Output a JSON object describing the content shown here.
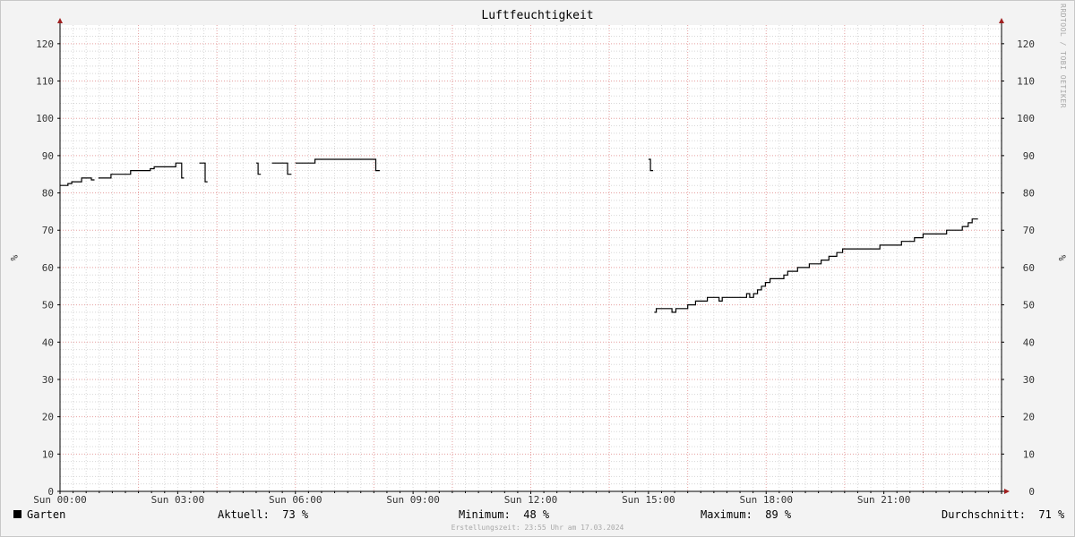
{
  "chart_data": {
    "type": "line",
    "title": "Luftfeuchtigkeit",
    "ylabel": "%",
    "ylim": [
      0,
      125
    ],
    "yticks": [
      "0",
      "10",
      "20",
      "30",
      "40",
      "50",
      "60",
      "70",
      "80",
      "90",
      "100",
      "110",
      "120"
    ],
    "xlim": [
      0,
      24
    ],
    "xticks": [
      {
        "x": 0,
        "label": "Sun 00:00"
      },
      {
        "x": 3,
        "label": "Sun 03:00"
      },
      {
        "x": 6,
        "label": "Sun 06:00"
      },
      {
        "x": 9,
        "label": "Sun 09:00"
      },
      {
        "x": 12,
        "label": "Sun 12:00"
      },
      {
        "x": 15,
        "label": "Sun 15:00"
      },
      {
        "x": 18,
        "label": "Sun 18:00"
      },
      {
        "x": 21,
        "label": "Sun 21:00"
      }
    ],
    "grid": true,
    "series": [
      {
        "name": "Garten",
        "color": "#000000",
        "segments": [
          [
            [
              0.0,
              82
            ],
            [
              0.2,
              82
            ],
            [
              0.2,
              82.5
            ],
            [
              0.3,
              82.5
            ],
            [
              0.3,
              83
            ],
            [
              0.55,
              83
            ],
            [
              0.55,
              84
            ],
            [
              0.8,
              84
            ],
            [
              0.8,
              83.5
            ],
            [
              0.88,
              83.5
            ]
          ],
          [
            [
              0.98,
              84
            ],
            [
              1.3,
              84
            ],
            [
              1.3,
              85
            ],
            [
              1.8,
              85
            ],
            [
              1.8,
              86
            ],
            [
              2.3,
              86
            ],
            [
              2.3,
              86.5
            ],
            [
              2.4,
              86.5
            ],
            [
              2.4,
              87
            ],
            [
              2.95,
              87
            ],
            [
              2.95,
              88
            ],
            [
              3.1,
              88
            ],
            [
              3.1,
              84
            ],
            [
              3.16,
              84
            ]
          ],
          [
            [
              3.55,
              88
            ],
            [
              3.7,
              88
            ],
            [
              3.7,
              83
            ],
            [
              3.76,
              83
            ]
          ],
          [
            [
              5.0,
              88
            ],
            [
              5.05,
              88
            ],
            [
              5.05,
              85
            ],
            [
              5.12,
              85
            ]
          ],
          [
            [
              5.4,
              88
            ],
            [
              5.8,
              88
            ],
            [
              5.8,
              85
            ],
            [
              5.9,
              85
            ]
          ],
          [
            [
              6.0,
              88
            ],
            [
              6.5,
              88
            ],
            [
              6.5,
              89
            ],
            [
              7.4,
              89
            ],
            [
              8.05,
              89
            ],
            [
              8.05,
              86
            ],
            [
              8.15,
              86
            ]
          ],
          [
            [
              15.0,
              89
            ],
            [
              15.05,
              89
            ],
            [
              15.05,
              86
            ],
            [
              15.12,
              86
            ]
          ],
          [
            [
              15.15,
              48
            ],
            [
              15.2,
              48
            ],
            [
              15.2,
              49
            ],
            [
              15.6,
              49
            ],
            [
              15.6,
              48
            ],
            [
              15.7,
              48
            ],
            [
              15.7,
              49
            ],
            [
              16.0,
              49
            ],
            [
              16.0,
              50
            ],
            [
              16.2,
              50
            ],
            [
              16.2,
              51
            ],
            [
              16.5,
              51
            ],
            [
              16.5,
              52
            ],
            [
              16.8,
              52
            ],
            [
              16.8,
              51
            ],
            [
              16.88,
              51
            ],
            [
              16.88,
              52
            ],
            [
              17.5,
              52
            ],
            [
              17.5,
              53
            ],
            [
              17.58,
              53
            ],
            [
              17.58,
              52
            ],
            [
              17.68,
              52
            ],
            [
              17.68,
              53
            ],
            [
              17.78,
              53
            ],
            [
              17.78,
              54
            ],
            [
              17.88,
              54
            ],
            [
              17.88,
              55
            ],
            [
              17.98,
              55
            ],
            [
              17.98,
              56
            ],
            [
              18.1,
              56
            ],
            [
              18.1,
              57
            ],
            [
              18.45,
              57
            ],
            [
              18.45,
              58
            ],
            [
              18.55,
              58
            ],
            [
              18.55,
              59
            ],
            [
              18.8,
              59
            ],
            [
              18.8,
              60
            ],
            [
              19.1,
              60
            ],
            [
              19.1,
              61
            ],
            [
              19.4,
              61
            ],
            [
              19.4,
              62
            ],
            [
              19.6,
              62
            ],
            [
              19.6,
              63
            ],
            [
              19.8,
              63
            ],
            [
              19.8,
              64
            ],
            [
              19.95,
              64
            ],
            [
              19.95,
              65
            ],
            [
              20.9,
              65
            ],
            [
              20.9,
              66
            ],
            [
              21.45,
              66
            ],
            [
              21.45,
              67
            ],
            [
              21.78,
              67
            ],
            [
              21.78,
              68
            ],
            [
              22.0,
              68
            ],
            [
              22.0,
              69
            ],
            [
              22.6,
              69
            ],
            [
              22.6,
              70
            ],
            [
              23.0,
              70
            ],
            [
              23.0,
              71
            ],
            [
              23.15,
              71
            ],
            [
              23.15,
              72
            ],
            [
              23.25,
              72
            ],
            [
              23.25,
              73
            ],
            [
              23.4,
              73
            ]
          ]
        ]
      }
    ]
  },
  "legend": {
    "series_name": "Garten",
    "current_label": "Aktuell:",
    "current_value": "73 %",
    "min_label": "Minimum:",
    "min_value": "48 %",
    "max_label": "Maximum:",
    "max_value": "89 %",
    "avg_label": "Durchschnitt:",
    "avg_value": "71 %"
  },
  "footer": "Erstellungszeit: 23:55 Uhr am 17.03.2024",
  "watermark": "RRDTOOL / TOBI OETIKER",
  "colors": {
    "minor_grid": "#d8d8d8",
    "major_grid": "#e6a0a0",
    "axis": "#000000",
    "arrow": "#a02020",
    "plot_bg": "#ffffff"
  }
}
